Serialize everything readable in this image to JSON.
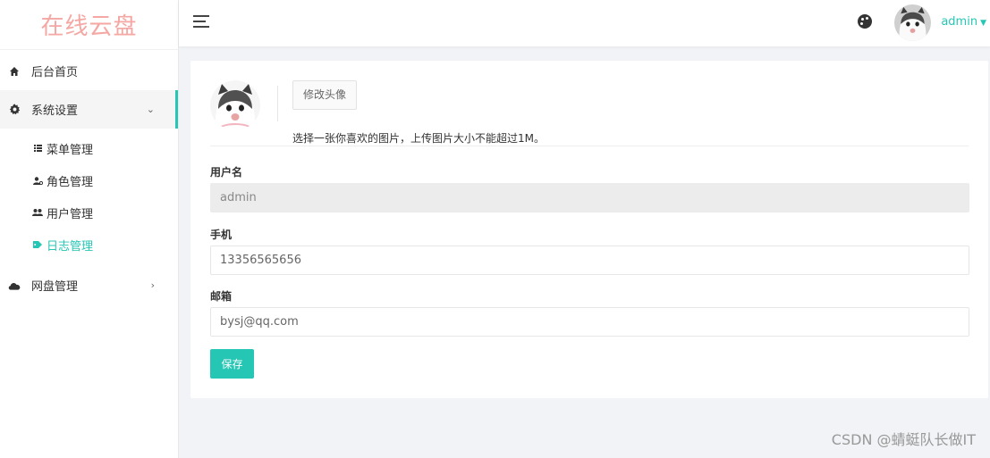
{
  "brand": {
    "title": "在线云盘",
    "color": "#f4a7a3"
  },
  "accent_color": "#26c6b4",
  "sidebar": {
    "items": [
      {
        "label": "后台首页",
        "icon": "home-icon"
      },
      {
        "label": "系统设置",
        "icon": "gear-icon",
        "expanded": true,
        "children": [
          {
            "label": "菜单管理",
            "icon": "list-icon"
          },
          {
            "label": "角色管理",
            "icon": "user-role-icon"
          },
          {
            "label": "用户管理",
            "icon": "users-icon"
          },
          {
            "label": "日志管理",
            "icon": "tag-icon",
            "active": true
          }
        ]
      },
      {
        "label": "网盘管理",
        "icon": "cloud-icon"
      }
    ]
  },
  "header": {
    "menu_toggle_icon": "hamburger-icon",
    "theme_icon": "palette-icon",
    "username": "admin"
  },
  "profile": {
    "change_avatar_label": "修改头像",
    "avatar_hint": "选择一张你喜欢的图片，上传图片大小不能超过1M。",
    "username_label": "用户名",
    "username_value": "admin",
    "phone_label": "手机",
    "phone_value": "13356565656",
    "email_label": "邮箱",
    "email_value": "bysj@qq.com",
    "save_label": "保存"
  },
  "watermark": "CSDN @蜻蜓队长做IT"
}
